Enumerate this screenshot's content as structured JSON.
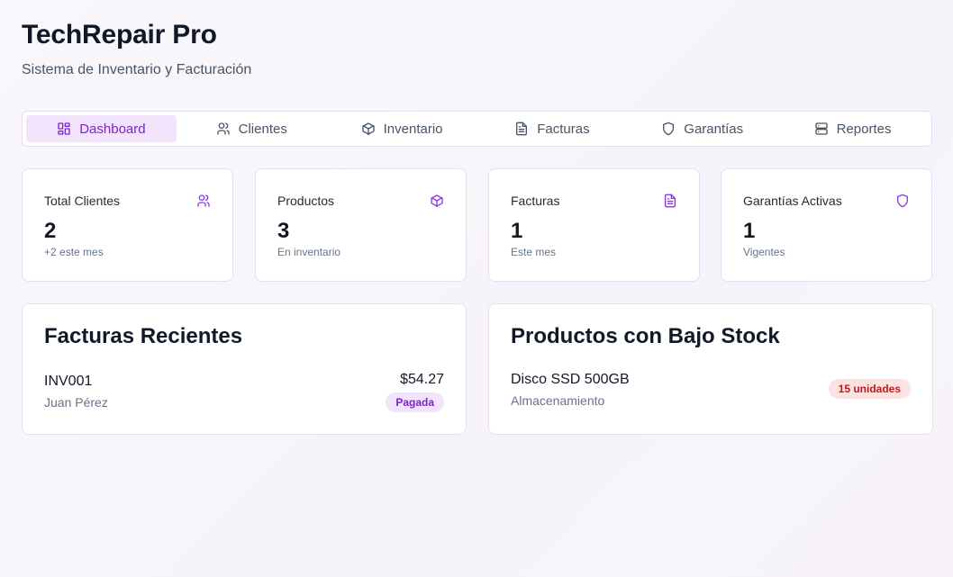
{
  "header": {
    "title": "TechRepair Pro",
    "subtitle": "Sistema de Inventario y Facturación"
  },
  "tabs": [
    {
      "label": "Dashboard",
      "icon": "dashboard-icon",
      "active": true
    },
    {
      "label": "Clientes",
      "icon": "users-icon",
      "active": false
    },
    {
      "label": "Inventario",
      "icon": "package-icon",
      "active": false
    },
    {
      "label": "Facturas",
      "icon": "file-text-icon",
      "active": false
    },
    {
      "label": "Garantías",
      "icon": "shield-icon",
      "active": false
    },
    {
      "label": "Reportes",
      "icon": "server-icon",
      "active": false
    }
  ],
  "stats": [
    {
      "title": "Total Clientes",
      "value": "2",
      "sub": "+2 este mes",
      "icon": "users-icon"
    },
    {
      "title": "Productos",
      "value": "3",
      "sub": "En inventario",
      "icon": "package-icon"
    },
    {
      "title": "Facturas",
      "value": "1",
      "sub": "Este mes",
      "icon": "file-text-icon"
    },
    {
      "title": "Garantías Activas",
      "value": "1",
      "sub": "Vigentes",
      "icon": "shield-icon"
    }
  ],
  "recent_invoices": {
    "title": "Facturas Recientes",
    "items": [
      {
        "id": "INV001",
        "customer": "Juan Pérez",
        "amount": "$54.27",
        "status": "Pagada"
      }
    ]
  },
  "low_stock": {
    "title": "Productos con Bajo Stock",
    "items": [
      {
        "name": "Disco SSD 500GB",
        "category": "Almacenamiento",
        "stock": "15 unidades"
      }
    ]
  },
  "colors": {
    "accent": "#9333ea",
    "accent_bg": "#f3e4fd",
    "danger": "#b91c1c",
    "danger_bg": "#fee2e2"
  }
}
